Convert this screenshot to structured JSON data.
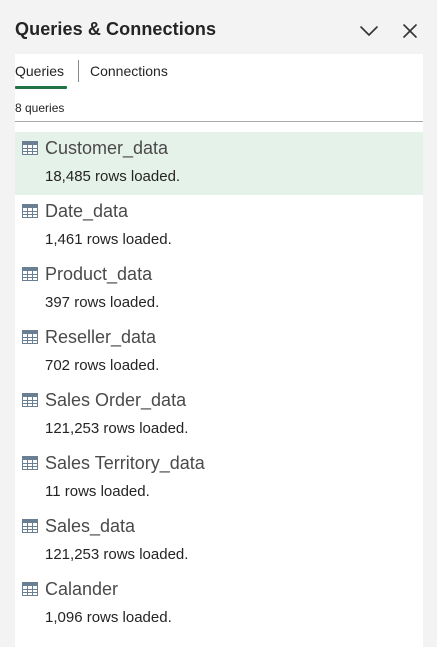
{
  "pane": {
    "title": "Queries & Connections",
    "collapse_icon": "chevron-down-icon",
    "close_icon": "close-icon"
  },
  "tabs": [
    {
      "label": "Queries",
      "active": true
    },
    {
      "label": "Connections",
      "active": false
    }
  ],
  "query_count": "8 queries",
  "colors": {
    "accent": "#217346",
    "selected_row": "#e5f2ea",
    "table_icon": "#6b7f93"
  },
  "queries": [
    {
      "name": "Customer_data",
      "status": "18,485 rows loaded.",
      "icon": "table-icon",
      "selected": true
    },
    {
      "name": "Date_data",
      "status": "1,461 rows loaded.",
      "icon": "table-icon",
      "selected": false
    },
    {
      "name": "Product_data",
      "status": "397 rows loaded.",
      "icon": "table-icon",
      "selected": false
    },
    {
      "name": "Reseller_data",
      "status": "702 rows loaded.",
      "icon": "table-icon",
      "selected": false
    },
    {
      "name": "Sales Order_data",
      "status": "121,253 rows loaded.",
      "icon": "table-icon",
      "selected": false
    },
    {
      "name": "Sales Territory_data",
      "status": "11 rows loaded.",
      "icon": "table-icon",
      "selected": false
    },
    {
      "name": "Sales_data",
      "status": "121,253 rows loaded.",
      "icon": "table-icon",
      "selected": false
    },
    {
      "name": "Calander",
      "status": "1,096 rows loaded.",
      "icon": "table-icon",
      "selected": false
    }
  ]
}
